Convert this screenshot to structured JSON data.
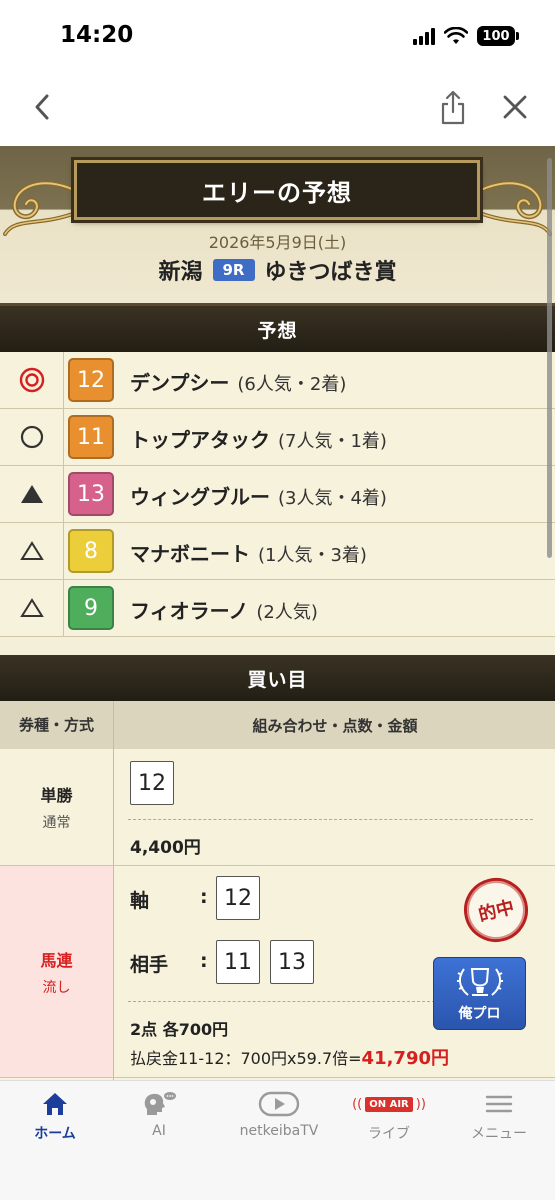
{
  "status": {
    "time": "14:20",
    "battery": "100"
  },
  "hero": {
    "title": "エリーの予想",
    "date": "2026年5月9日(土)",
    "venue": "新潟",
    "race_no": "9R",
    "race_name": "ゆきつばき賞"
  },
  "prediction": {
    "heading": "予想",
    "rows": [
      {
        "mark": "double-circle",
        "num": "12",
        "color": "#e8902f",
        "name": "デンプシー",
        "info": "(6人気・2着)"
      },
      {
        "mark": "circle",
        "num": "11",
        "color": "#e8902f",
        "name": "トップアタック",
        "info": "(7人気・1着)"
      },
      {
        "mark": "filled-triangle",
        "num": "13",
        "color": "#d6628c",
        "name": "ウィングブルー",
        "info": "(3人気・4着)"
      },
      {
        "mark": "triangle",
        "num": "8",
        "color": "#eccd3a",
        "name": "マナボニート",
        "info": "(1人気・3着)"
      },
      {
        "mark": "triangle",
        "num": "9",
        "color": "#4fae5c",
        "name": "フィオラーノ",
        "info": "(2人気)"
      }
    ]
  },
  "bets": {
    "heading": "買い目",
    "col_type": "券種・方式",
    "col_detail": "組み合わせ・点数・金額",
    "win": {
      "type": "単勝",
      "method": "通常",
      "num": "12",
      "amount": "4,400円"
    },
    "quinella": {
      "type": "馬連",
      "method": "流し",
      "axis_label": "軸",
      "axis_num": "12",
      "partner_label": "相手",
      "partner_nums": [
        "11",
        "13"
      ],
      "points": "2点 各700円",
      "payout_prefix": "払戻金11-12：700円x59.7倍=",
      "payout_total": "41,790円",
      "stamp": "的中",
      "pro_badge": "俺プロ"
    }
  },
  "tabs": [
    {
      "label": "ホーム",
      "icon": "home-icon",
      "active": true
    },
    {
      "label": "AI",
      "icon": "ai-head-icon",
      "active": false
    },
    {
      "label": "netkeibaTV",
      "icon": "play-icon",
      "active": false
    },
    {
      "label": "ライブ",
      "icon": "onair-icon",
      "active": false,
      "badge": "ON AIR"
    },
    {
      "label": "メニュー",
      "icon": "menu-icon",
      "active": false
    }
  ],
  "colors": {
    "accent_blue": "#3f6cc4",
    "hit_red": "#b81f1f",
    "payout_red": "#d62020",
    "bet_highlight": "#fde3e0"
  }
}
